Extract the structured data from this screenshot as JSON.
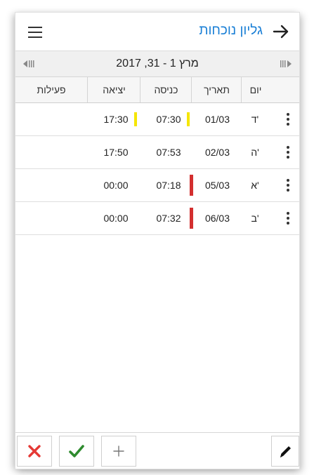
{
  "header": {
    "title": "גליון נוכחות",
    "title_color": "#1a7fd6",
    "menu_icon": "hamburger-menu-icon",
    "back_icon": "arrow-right-icon"
  },
  "date_bar": {
    "range": "2017 ,31 - 1 מרץ",
    "prev_icon": "prev-period-icon",
    "next_icon": "next-period-icon"
  },
  "table": {
    "columns": {
      "day": "יום",
      "date": "תאריך",
      "in": "כניסה",
      "out": "יציאה",
      "actions": "פעילות"
    },
    "rows": [
      {
        "day": "ד'",
        "date": "01/03",
        "in": "07:30",
        "out": "17:30",
        "in_mark": "yellow",
        "out_mark": "yellow"
      },
      {
        "day": "ה'",
        "date": "02/03",
        "in": "07:53",
        "out": "17:50",
        "in_mark": "",
        "out_mark": ""
      },
      {
        "day": "א'",
        "date": "05/03",
        "in": "07:18",
        "out": "00:00",
        "in_mark": "red",
        "out_mark": ""
      },
      {
        "day": "ב'",
        "date": "06/03",
        "in": "07:32",
        "out": "00:00",
        "in_mark": "red",
        "out_mark": ""
      }
    ],
    "row_menu_icon": "more-vertical-icon"
  },
  "footer": {
    "cancel_icon": "close-icon",
    "confirm_icon": "check-icon",
    "add_icon": "plus-icon",
    "edit_icon": "pencil-icon",
    "cancel_color": "#e53935",
    "confirm_color": "#2e8b2e"
  }
}
